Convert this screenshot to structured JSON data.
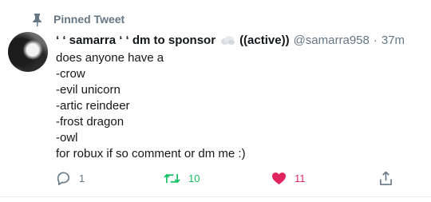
{
  "pinned": {
    "label": "Pinned Tweet"
  },
  "tweet": {
    "display_name": "‘ ‘ samarra ‘ ‘ dm to sponsor",
    "status": "((active))",
    "handle": "@samarra958",
    "separator": "·",
    "time": "37m",
    "lines": [
      "does anyone have a",
      "-crow",
      "-evil unicorn",
      "-artic reindeer",
      "-frost dragon",
      "-owl",
      "for robux if so comment or dm me :)"
    ]
  },
  "actions": {
    "reply_count": "1",
    "retweet_count": "10",
    "like_count": "11"
  },
  "colors": {
    "secondary": "#657786",
    "retweet": "#17bf63",
    "like": "#e0245e"
  },
  "icons": [
    "pin-icon",
    "cloud-emoji-icon",
    "reply-icon",
    "retweet-icon",
    "heart-icon",
    "share-icon"
  ]
}
